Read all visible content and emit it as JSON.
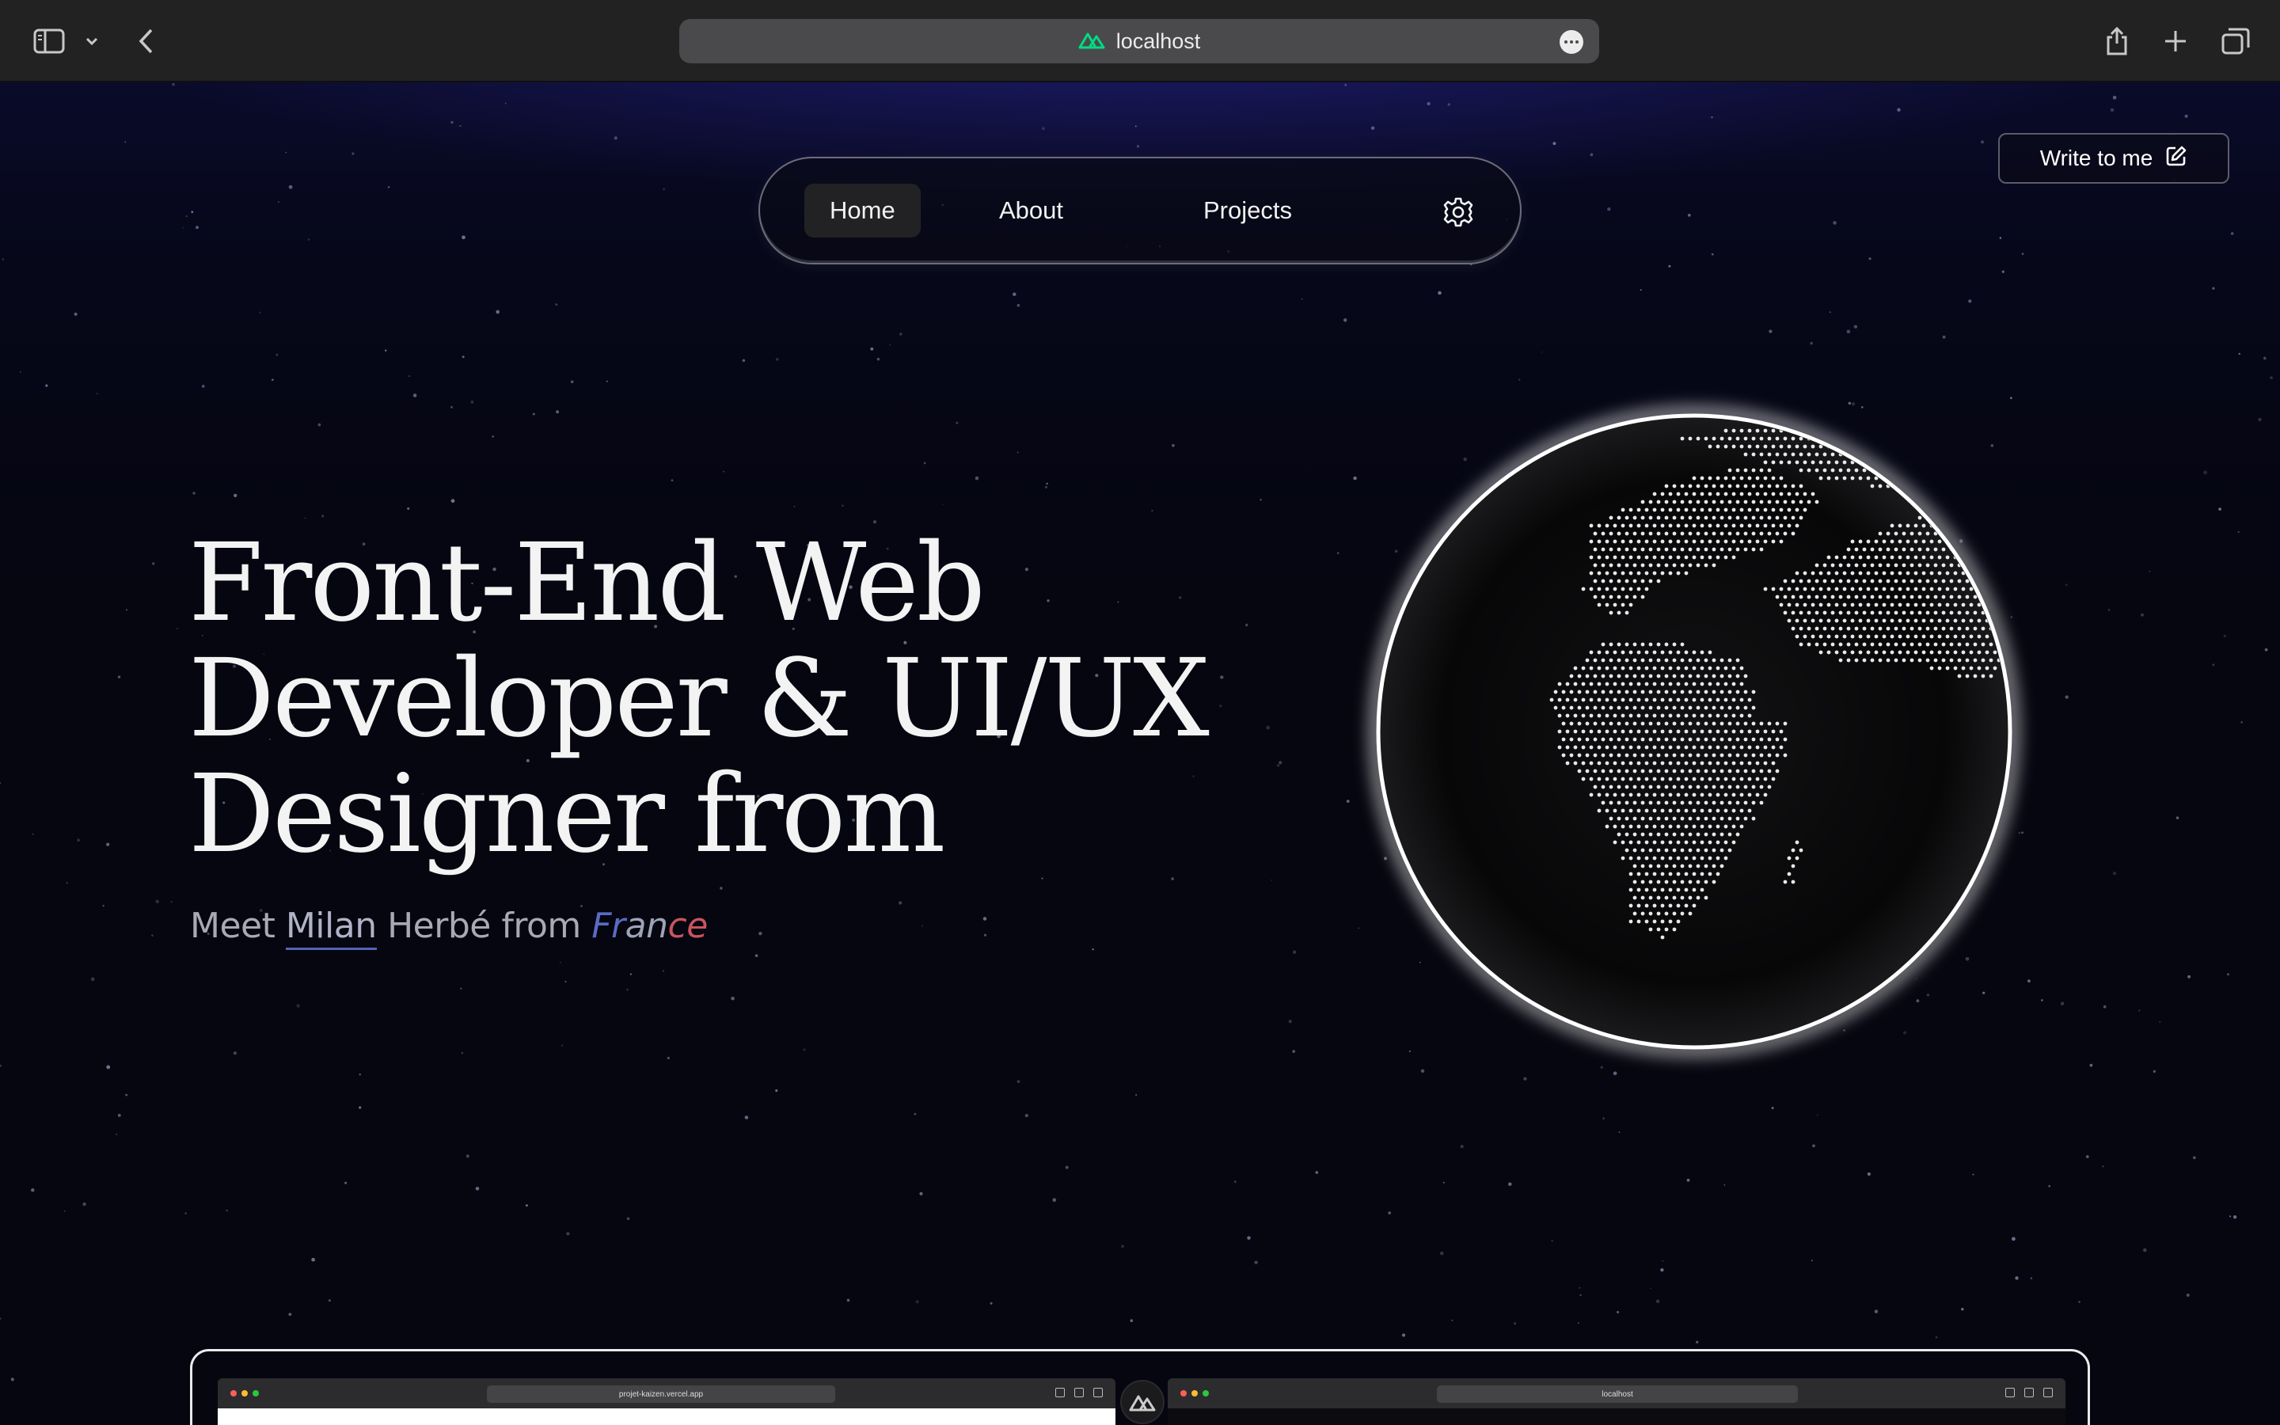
{
  "browser": {
    "address": "localhost",
    "icons": [
      "sidebar-icon",
      "chevron-down-icon",
      "back-icon",
      "nuxt-logo-icon",
      "more-icon",
      "share-icon",
      "new-tab-icon",
      "tabs-overview-icon"
    ]
  },
  "nav": {
    "items": [
      {
        "label": "Home",
        "active": true
      },
      {
        "label": "About",
        "active": false
      },
      {
        "label": "Projects",
        "active": false
      }
    ],
    "settings_icon": "gear-icon"
  },
  "cta": {
    "label": "Write to me",
    "icon": "edit-icon"
  },
  "hero": {
    "title_lines": [
      "Front-End Web",
      "Developer & UI/UX",
      "Designer from"
    ],
    "subtitle": {
      "prefix": "Meet ",
      "name": "Milan",
      "middle": " Herbé from ",
      "country": "France"
    }
  },
  "preview": {
    "left_url": "projet-kaizen.vercel.app",
    "right_url": "localhost"
  },
  "colors": {
    "background": "#05060f",
    "accent_blue": "#5763b8",
    "france_blue": "#5a6bc4",
    "france_white": "#9fa3b8",
    "france_red": "#c9545f",
    "nuxt_green": "#00dc82"
  }
}
